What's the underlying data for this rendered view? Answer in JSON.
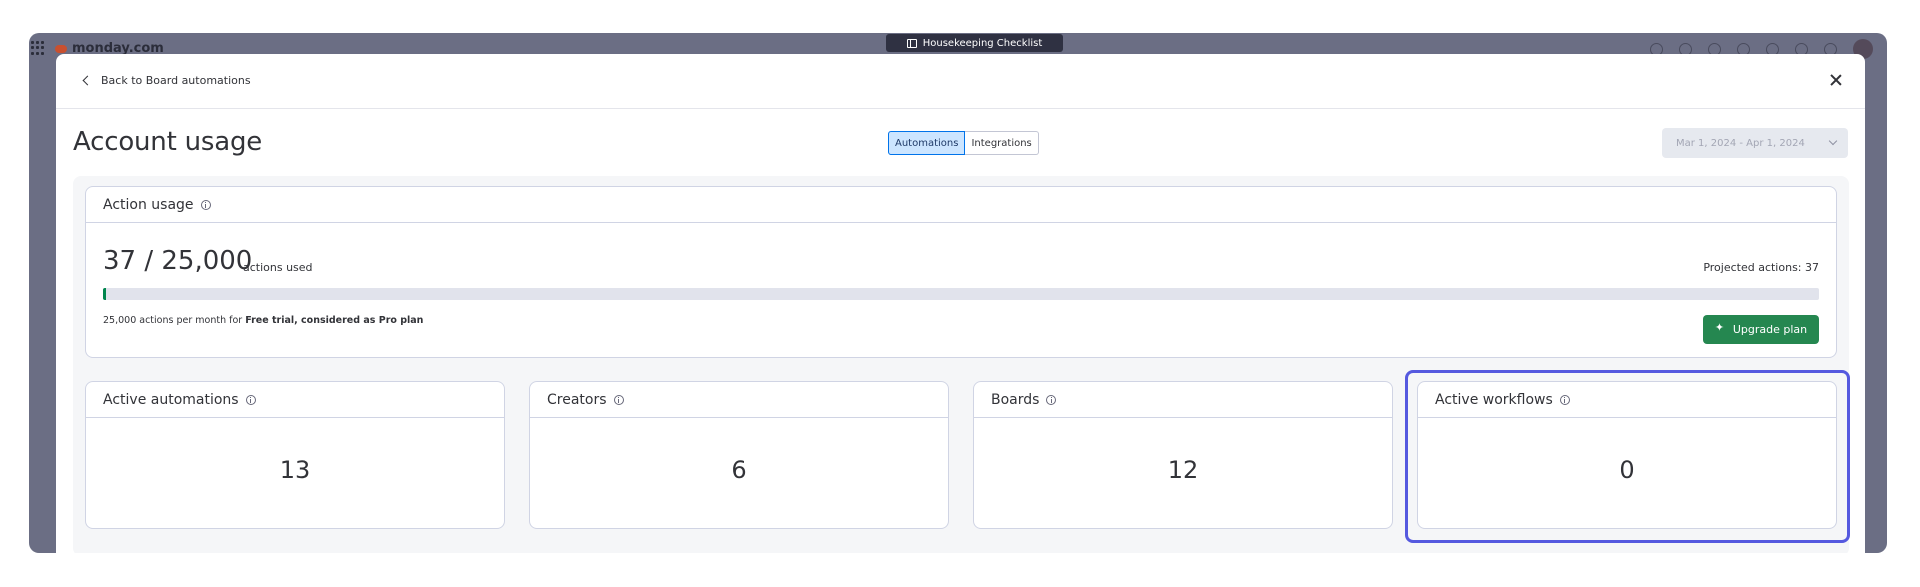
{
  "app": {
    "logo_text": "monday.com",
    "board_name": "Housekeeping Checklist"
  },
  "modal": {
    "back_label": "Back to Board automations",
    "title": "Account usage",
    "tabs": [
      {
        "label": "Automations",
        "active": true
      },
      {
        "label": "Integrations",
        "active": false
      }
    ],
    "date_range": "Mar 1, 2024 - Apr 1, 2024"
  },
  "action_usage": {
    "title": "Action usage",
    "used": 37,
    "limit": 25000,
    "count_text": "37 / 25,000",
    "suffix": "actions used",
    "projected": "Projected actions: 37",
    "plan_prefix": "25,000 actions per month for ",
    "plan_name": "Free trial, considered as Pro plan",
    "upgrade_label": "Upgrade plan"
  },
  "stats": [
    {
      "title": "Active automations",
      "value": "13"
    },
    {
      "title": "Creators",
      "value": "6"
    },
    {
      "title": "Boards",
      "value": "12"
    },
    {
      "title": "Active workflows",
      "value": "0"
    }
  ],
  "colors": {
    "accent": "#0073ea",
    "progress": "#00854d",
    "upgrade": "#258750",
    "highlight": "#5559df"
  }
}
